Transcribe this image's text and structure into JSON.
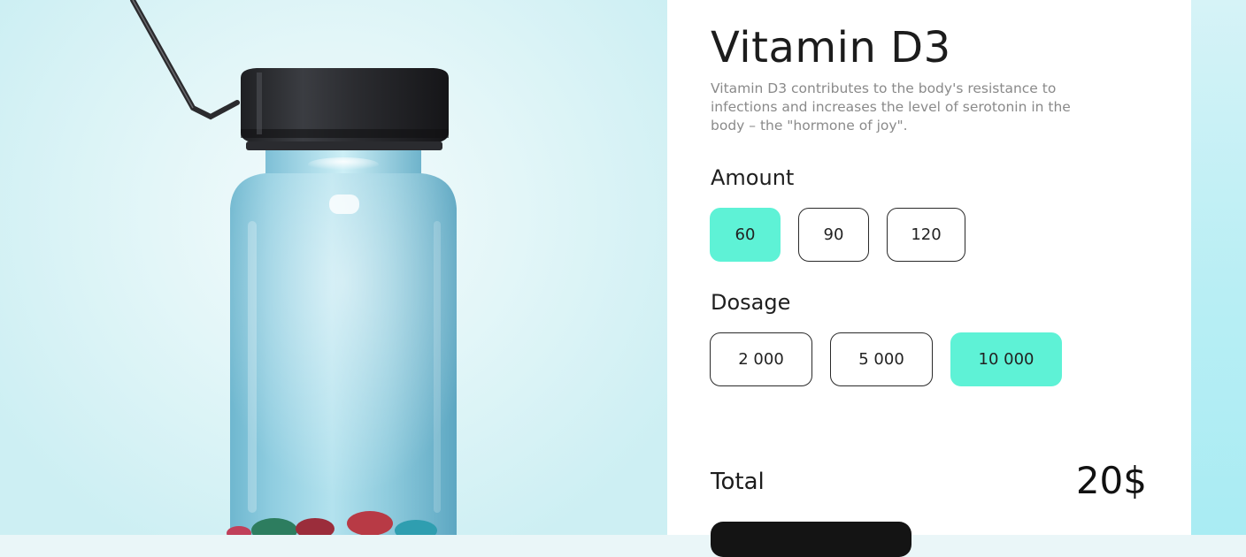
{
  "product": {
    "name": "Vitamin D3",
    "description": "Vitamin D3 contributes to the body's resistance to infections and increases the level of serotonin in the body – the \"hormone of joy\"."
  },
  "amount": {
    "label": "Amount",
    "options": [
      "60",
      "90",
      "120"
    ],
    "selected": "60"
  },
  "dosage": {
    "label": "Dosage",
    "options": [
      "2 000",
      "5 000",
      "10 000"
    ],
    "selected": "10 000"
  },
  "total": {
    "label": "Total",
    "price": "20$"
  },
  "colors": {
    "accent": "#5ef2d6",
    "panel": "#ffffff",
    "text": "#1c1c1c",
    "muted": "#8a8a8a",
    "button": "#141414"
  }
}
